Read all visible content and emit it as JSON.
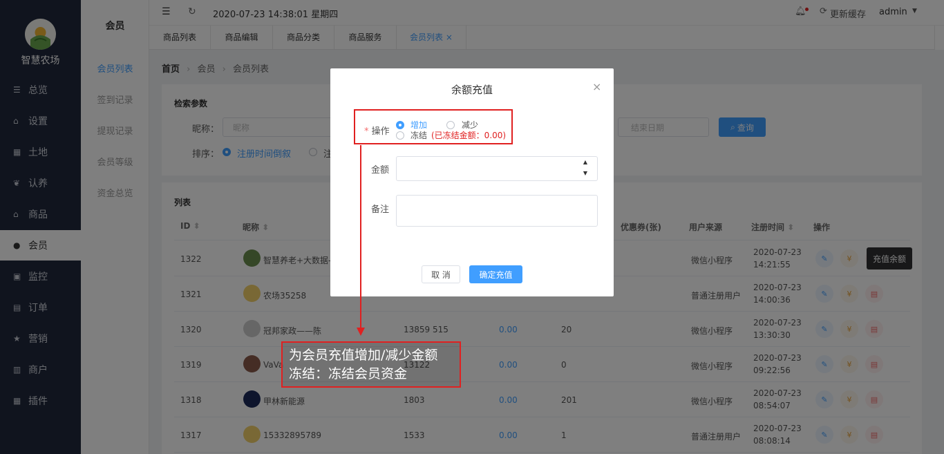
{
  "sidebar": {
    "brand": "智慧农场",
    "items": [
      {
        "label": "总览",
        "icon": "sliders-icon",
        "glyph": "☰"
      },
      {
        "label": "设置",
        "icon": "bag-icon",
        "glyph": "⌂"
      },
      {
        "label": "土地",
        "icon": "grid-icon",
        "glyph": "▦"
      },
      {
        "label": "认养",
        "icon": "sprout-icon",
        "glyph": "❦"
      },
      {
        "label": "商品",
        "icon": "bag-icon",
        "glyph": "⌂"
      },
      {
        "label": "会员",
        "icon": "user-icon",
        "glyph": "●"
      },
      {
        "label": "监控",
        "icon": "camera-icon",
        "glyph": "▣"
      },
      {
        "label": "订单",
        "icon": "clipboard-icon",
        "glyph": "▤"
      },
      {
        "label": "营销",
        "icon": "star-icon",
        "glyph": "★"
      },
      {
        "label": "商户",
        "icon": "store-icon",
        "glyph": "▥"
      },
      {
        "label": "插件",
        "icon": "grid-icon",
        "glyph": "▦"
      }
    ]
  },
  "subnav": {
    "title": "会员",
    "items": [
      "会员列表",
      "签到记录",
      "提现记录",
      "会员等级",
      "资金总览"
    ]
  },
  "topbar": {
    "datetime": "2020-07-23 14:38:01 星期四",
    "refresh": "更新缓存",
    "user": "admin"
  },
  "tabs": [
    "商品列表",
    "商品编辑",
    "商品分类",
    "商品服务",
    "会员列表"
  ],
  "breadcrumb": {
    "home": "首页",
    "level1": "会员",
    "level2": "会员列表"
  },
  "search": {
    "title": "检索参数",
    "nickname_label": "昵称：",
    "nickname_placeholder": "昵称",
    "end_date_placeholder": "结束日期",
    "query_button": "查询",
    "sort_label": "排序：",
    "sort_option1": "注册时间倒叙",
    "sort_option2": "注"
  },
  "list": {
    "title": "列表",
    "headers": {
      "id": "ID",
      "nickname": "昵称",
      "coupon": "优惠券(张)",
      "source": "用户来源",
      "regtime": "注册时间",
      "action": "操作"
    },
    "rows": [
      {
        "id": "1322",
        "nick": "智慧养老+大数据-",
        "phone": "",
        "balance": "",
        "coupon": "",
        "source": "微信小程序",
        "date": "2020-07-23",
        "time": "14:21:55",
        "avatar": "#6b8e4e"
      },
      {
        "id": "1321",
        "nick": "农场35258",
        "phone": "",
        "balance": "",
        "coupon": "",
        "source": "普通注册用户",
        "date": "2020-07-23",
        "time": "14:00:36",
        "avatar": "#f2d16b"
      },
      {
        "id": "1320",
        "nick": "冠邦家政——陈",
        "phone": "13859    515",
        "balance": "0.00",
        "coupon": "20",
        "source": "微信小程序",
        "date": "2020-07-23",
        "time": "13:30:30",
        "avatar": "#cccccc"
      },
      {
        "id": "1319",
        "nick": "VaVa",
        "phone": "13122",
        "balance": "0.00",
        "coupon": "0",
        "source": "微信小程序",
        "date": "2020-07-23",
        "time": "09:22:56",
        "avatar": "#8a5a4a"
      },
      {
        "id": "1318",
        "nick": "甲林新能源",
        "phone": "1803",
        "balance": "0.00",
        "coupon": "201",
        "source": "微信小程序",
        "date": "2020-07-23",
        "time": "08:54:07",
        "avatar": "#1c2a5a"
      },
      {
        "id": "1317",
        "nick": "15332895789",
        "phone": "1533",
        "balance": "0.00",
        "coupon": "1",
        "source": "普通注册用户",
        "date": "2020-07-23",
        "time": "08:08:14",
        "avatar": "#f2d16b"
      }
    ],
    "tooltip": "充值余额"
  },
  "dialog": {
    "title": "余额充值",
    "op_label": "操作",
    "required_mark": "*",
    "opt_add": "增加",
    "opt_sub": "减少",
    "opt_freeze": "冻结",
    "frozen_note": "(已冻结金额：0.00)",
    "amount_label": "金额",
    "remark_label": "备注",
    "cancel": "取 消",
    "confirm": "确定充值"
  },
  "annotation": {
    "line1": "为会员充值增加/减少金额",
    "line2": "冻结：冻结会员资金"
  },
  "colors": {
    "sidebar": "#20283d",
    "primary": "#409eff",
    "annotation": "#e02020"
  }
}
